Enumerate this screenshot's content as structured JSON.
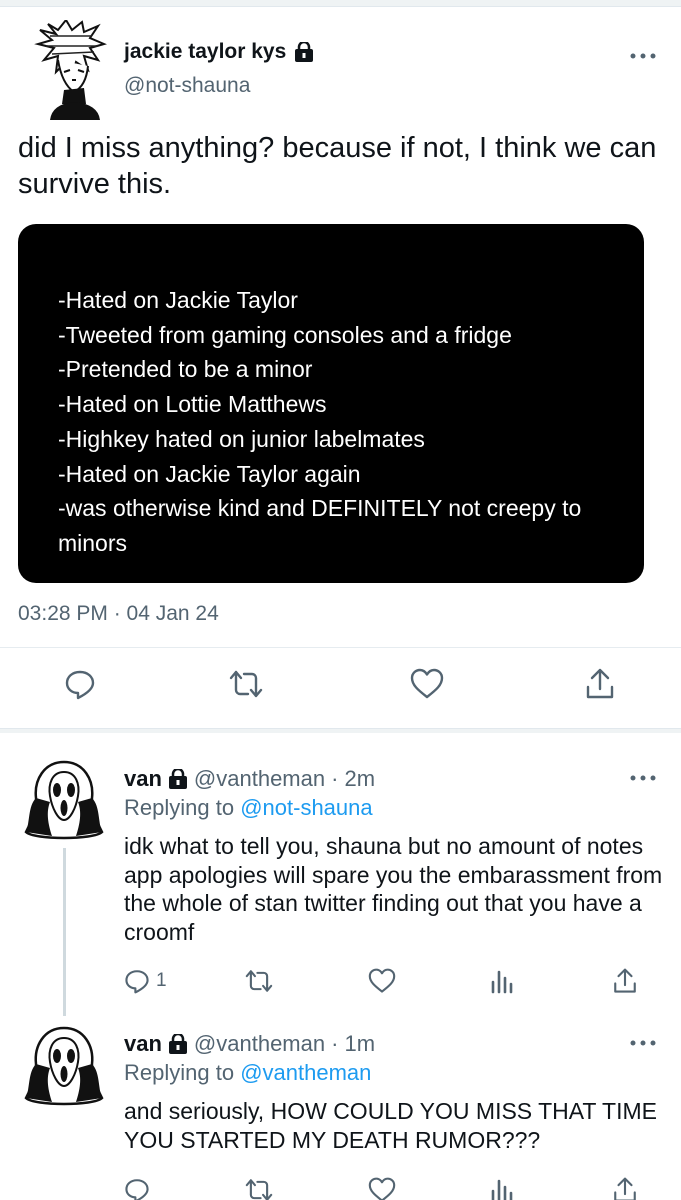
{
  "main_tweet": {
    "display_name": "jackie taylor kys",
    "handle": "@not-shauna",
    "icons": {
      "lock": "lock-icon",
      "more": "more-dots-icon"
    },
    "text": "did I miss anything? because if not, I think we can survive this.",
    "note_lines": [
      "-Hated on Jackie Taylor",
      "-Tweeted from gaming consoles and a fridge",
      "-Pretended to be a minor",
      "-Hated on Lottie Matthews",
      "-Highkey hated on junior labelmates",
      "-Hated on Jackie Taylor again",
      "-was otherwise kind and DEFINITELY not creepy to minors"
    ],
    "timestamp": "03:28 PM · 04 Jan 24",
    "actions": [
      "reply-icon",
      "retweet-icon",
      "like-icon",
      "share-icon"
    ]
  },
  "replies": [
    {
      "display_name": "van",
      "handle": "@vantheman",
      "time": "· 2m",
      "replying_prefix": "Replying to",
      "replying_to": "@not-shauna",
      "text": "idk what to tell you, shauna but no amount of notes app apologies will spare you the embarassment from the whole of stan twitter finding out that you have a croomf",
      "reply_count": "1",
      "actions": [
        "reply-icon",
        "retweet-icon",
        "like-icon",
        "analytics-icon",
        "share-icon"
      ]
    },
    {
      "display_name": "van",
      "handle": "@vantheman",
      "time": "· 1m",
      "replying_prefix": "Replying to",
      "replying_to": "@vantheman",
      "text": "and seriously, HOW COULD YOU MISS THAT TIME YOU STARTED MY DEATH RUMOR???",
      "reply_count": "",
      "actions": [
        "reply-icon",
        "retweet-icon",
        "like-icon",
        "analytics-icon",
        "share-icon"
      ]
    }
  ],
  "colors": {
    "text": "#0f1419",
    "secondary": "#536471",
    "link": "#1d9bf0",
    "note_background": "#000000",
    "divider": "#e6ecf0"
  }
}
